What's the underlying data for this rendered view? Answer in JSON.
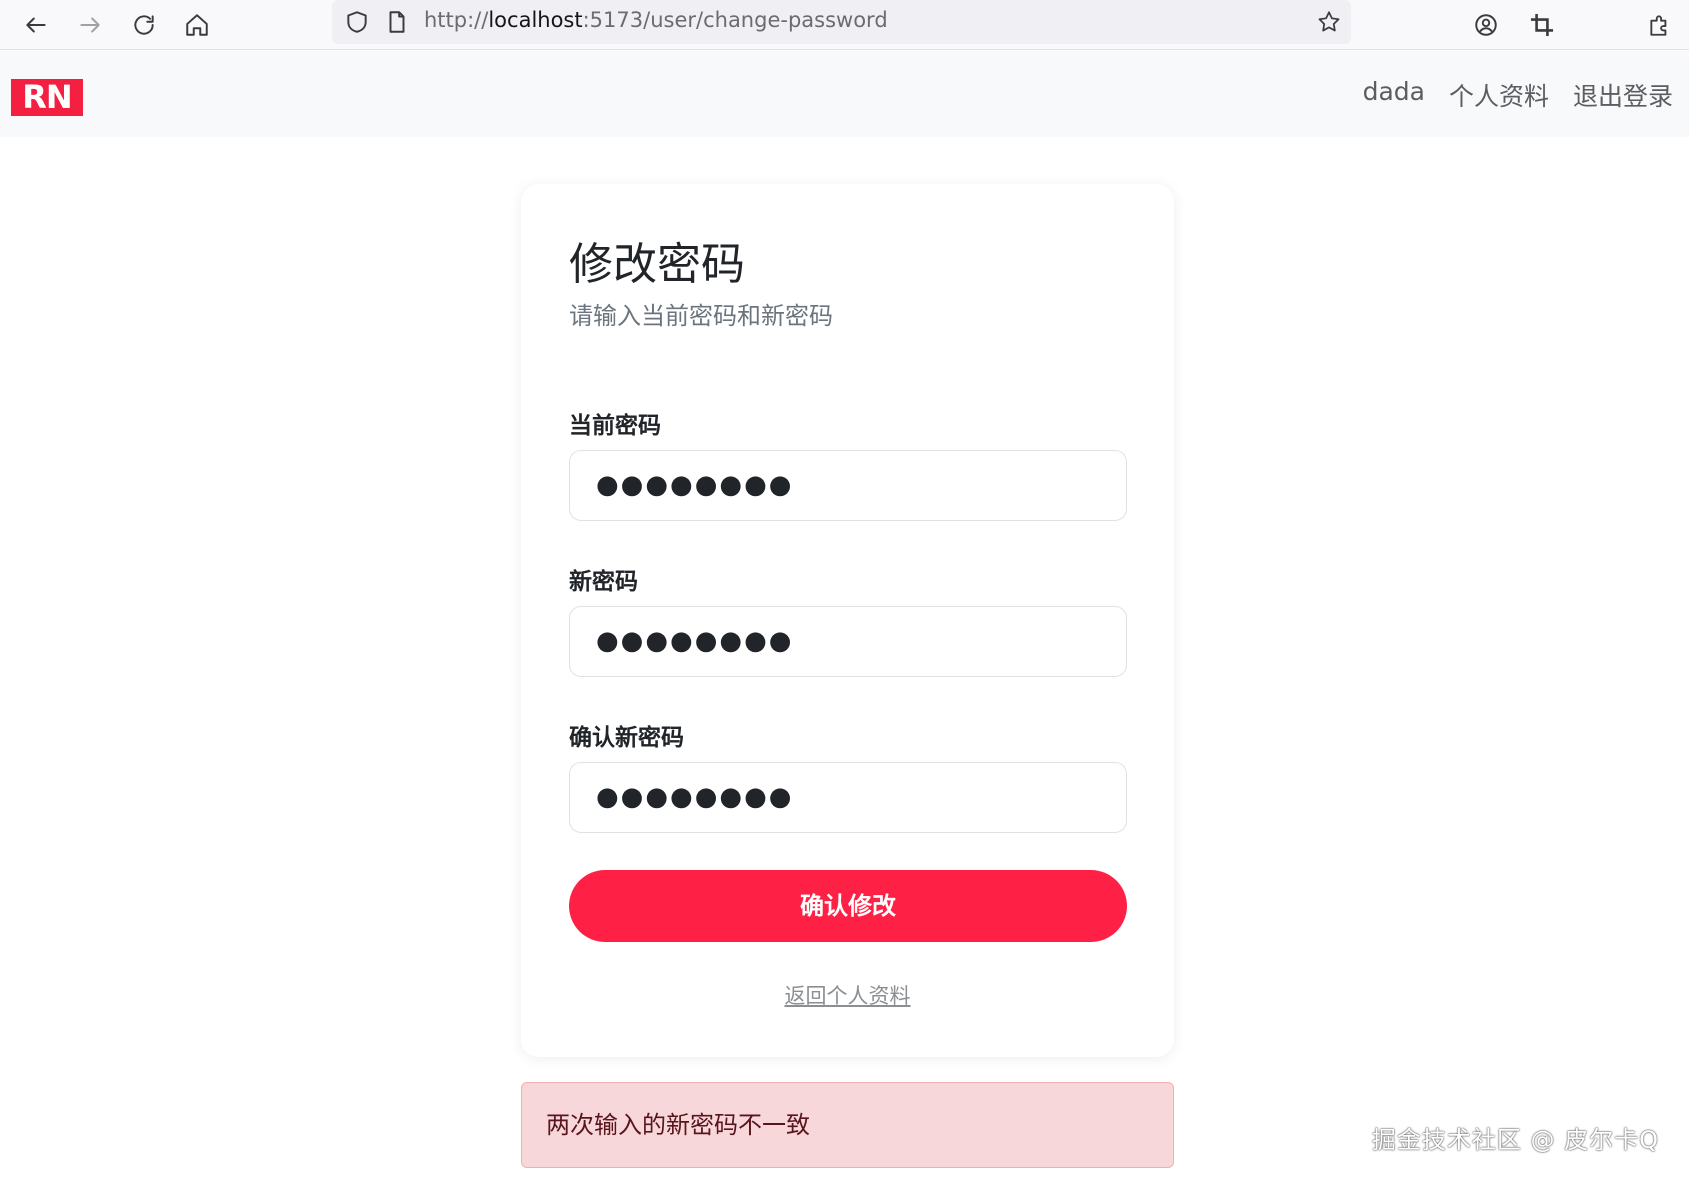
{
  "browser": {
    "url_scheme": "http://",
    "url_host": "localhost",
    "url_rest": ":5173/user/change-password",
    "icons": [
      "back-arrow-icon",
      "forward-arrow-icon",
      "reload-icon",
      "home-icon",
      "shield-icon",
      "page-icon",
      "star-icon",
      "account-icon",
      "crop-icon",
      "extensions-icon"
    ]
  },
  "header": {
    "logo": "RN",
    "nav": {
      "username": "dada",
      "profile": "个人资料",
      "logout": "退出登录"
    }
  },
  "card": {
    "title": "修改密码",
    "subtitle": "请输入当前密码和新密码",
    "fields": [
      {
        "label": "当前密码",
        "value": "●●●●●●●●"
      },
      {
        "label": "新密码",
        "value": "●●●●●●●●"
      },
      {
        "label": "确认新密码",
        "value": "●●●●●●●●"
      }
    ],
    "submit_label": "确认修改",
    "back_link": "返回个人资料"
  },
  "alert": {
    "message": "两次输入的新密码不一致"
  },
  "watermark": "掘金技术社区 @ 皮尔卡Q",
  "colors": {
    "brand": "#f42042",
    "button": "#ff2145",
    "alert_bg": "#f8d7da",
    "alert_text": "#58151c"
  }
}
